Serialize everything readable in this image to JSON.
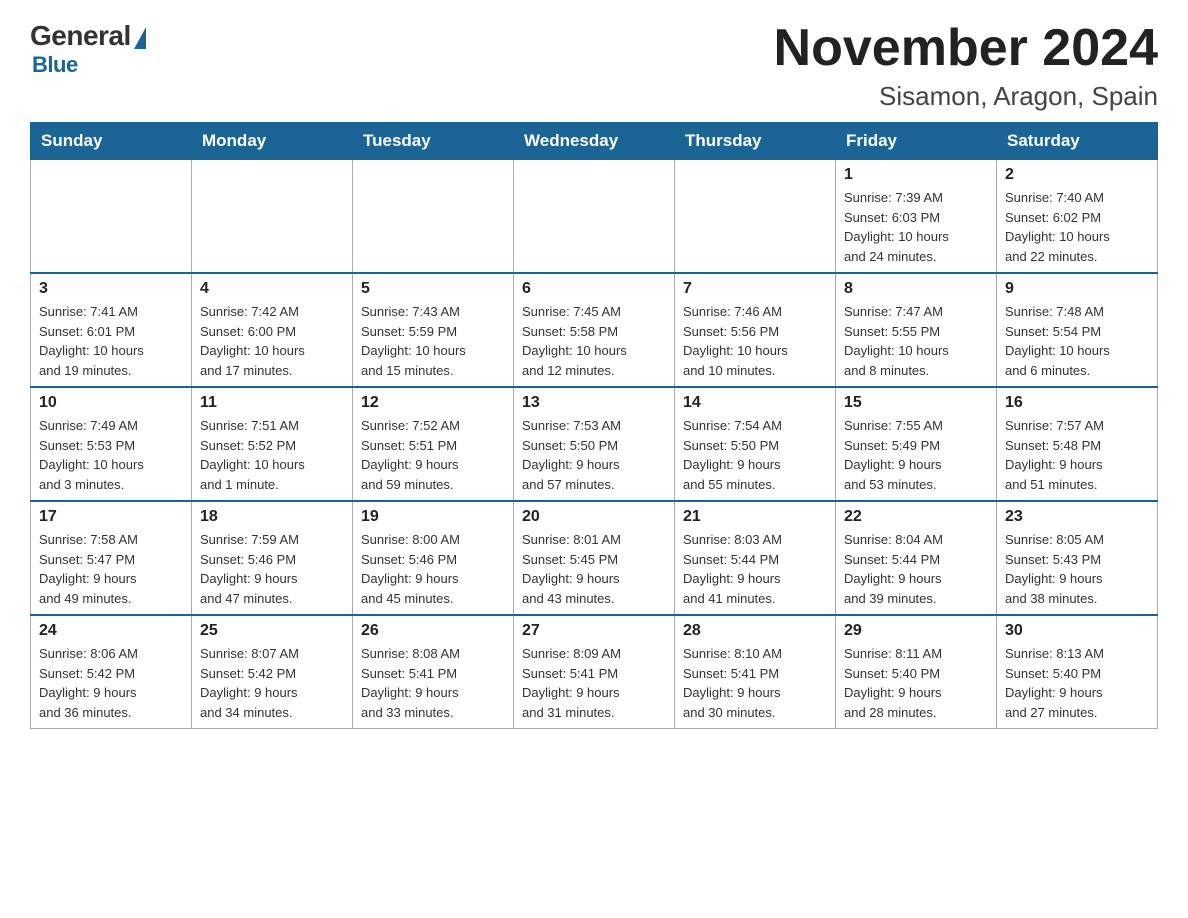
{
  "logo": {
    "general": "General",
    "blue": "Blue"
  },
  "header": {
    "month": "November 2024",
    "location": "Sisamon, Aragon, Spain"
  },
  "days_of_week": [
    "Sunday",
    "Monday",
    "Tuesday",
    "Wednesday",
    "Thursday",
    "Friday",
    "Saturday"
  ],
  "weeks": [
    [
      {
        "day": "",
        "info": ""
      },
      {
        "day": "",
        "info": ""
      },
      {
        "day": "",
        "info": ""
      },
      {
        "day": "",
        "info": ""
      },
      {
        "day": "",
        "info": ""
      },
      {
        "day": "1",
        "info": "Sunrise: 7:39 AM\nSunset: 6:03 PM\nDaylight: 10 hours\nand 24 minutes."
      },
      {
        "day": "2",
        "info": "Sunrise: 7:40 AM\nSunset: 6:02 PM\nDaylight: 10 hours\nand 22 minutes."
      }
    ],
    [
      {
        "day": "3",
        "info": "Sunrise: 7:41 AM\nSunset: 6:01 PM\nDaylight: 10 hours\nand 19 minutes."
      },
      {
        "day": "4",
        "info": "Sunrise: 7:42 AM\nSunset: 6:00 PM\nDaylight: 10 hours\nand 17 minutes."
      },
      {
        "day": "5",
        "info": "Sunrise: 7:43 AM\nSunset: 5:59 PM\nDaylight: 10 hours\nand 15 minutes."
      },
      {
        "day": "6",
        "info": "Sunrise: 7:45 AM\nSunset: 5:58 PM\nDaylight: 10 hours\nand 12 minutes."
      },
      {
        "day": "7",
        "info": "Sunrise: 7:46 AM\nSunset: 5:56 PM\nDaylight: 10 hours\nand 10 minutes."
      },
      {
        "day": "8",
        "info": "Sunrise: 7:47 AM\nSunset: 5:55 PM\nDaylight: 10 hours\nand 8 minutes."
      },
      {
        "day": "9",
        "info": "Sunrise: 7:48 AM\nSunset: 5:54 PM\nDaylight: 10 hours\nand 6 minutes."
      }
    ],
    [
      {
        "day": "10",
        "info": "Sunrise: 7:49 AM\nSunset: 5:53 PM\nDaylight: 10 hours\nand 3 minutes."
      },
      {
        "day": "11",
        "info": "Sunrise: 7:51 AM\nSunset: 5:52 PM\nDaylight: 10 hours\nand 1 minute."
      },
      {
        "day": "12",
        "info": "Sunrise: 7:52 AM\nSunset: 5:51 PM\nDaylight: 9 hours\nand 59 minutes."
      },
      {
        "day": "13",
        "info": "Sunrise: 7:53 AM\nSunset: 5:50 PM\nDaylight: 9 hours\nand 57 minutes."
      },
      {
        "day": "14",
        "info": "Sunrise: 7:54 AM\nSunset: 5:50 PM\nDaylight: 9 hours\nand 55 minutes."
      },
      {
        "day": "15",
        "info": "Sunrise: 7:55 AM\nSunset: 5:49 PM\nDaylight: 9 hours\nand 53 minutes."
      },
      {
        "day": "16",
        "info": "Sunrise: 7:57 AM\nSunset: 5:48 PM\nDaylight: 9 hours\nand 51 minutes."
      }
    ],
    [
      {
        "day": "17",
        "info": "Sunrise: 7:58 AM\nSunset: 5:47 PM\nDaylight: 9 hours\nand 49 minutes."
      },
      {
        "day": "18",
        "info": "Sunrise: 7:59 AM\nSunset: 5:46 PM\nDaylight: 9 hours\nand 47 minutes."
      },
      {
        "day": "19",
        "info": "Sunrise: 8:00 AM\nSunset: 5:46 PM\nDaylight: 9 hours\nand 45 minutes."
      },
      {
        "day": "20",
        "info": "Sunrise: 8:01 AM\nSunset: 5:45 PM\nDaylight: 9 hours\nand 43 minutes."
      },
      {
        "day": "21",
        "info": "Sunrise: 8:03 AM\nSunset: 5:44 PM\nDaylight: 9 hours\nand 41 minutes."
      },
      {
        "day": "22",
        "info": "Sunrise: 8:04 AM\nSunset: 5:44 PM\nDaylight: 9 hours\nand 39 minutes."
      },
      {
        "day": "23",
        "info": "Sunrise: 8:05 AM\nSunset: 5:43 PM\nDaylight: 9 hours\nand 38 minutes."
      }
    ],
    [
      {
        "day": "24",
        "info": "Sunrise: 8:06 AM\nSunset: 5:42 PM\nDaylight: 9 hours\nand 36 minutes."
      },
      {
        "day": "25",
        "info": "Sunrise: 8:07 AM\nSunset: 5:42 PM\nDaylight: 9 hours\nand 34 minutes."
      },
      {
        "day": "26",
        "info": "Sunrise: 8:08 AM\nSunset: 5:41 PM\nDaylight: 9 hours\nand 33 minutes."
      },
      {
        "day": "27",
        "info": "Sunrise: 8:09 AM\nSunset: 5:41 PM\nDaylight: 9 hours\nand 31 minutes."
      },
      {
        "day": "28",
        "info": "Sunrise: 8:10 AM\nSunset: 5:41 PM\nDaylight: 9 hours\nand 30 minutes."
      },
      {
        "day": "29",
        "info": "Sunrise: 8:11 AM\nSunset: 5:40 PM\nDaylight: 9 hours\nand 28 minutes."
      },
      {
        "day": "30",
        "info": "Sunrise: 8:13 AM\nSunset: 5:40 PM\nDaylight: 9 hours\nand 27 minutes."
      }
    ]
  ]
}
